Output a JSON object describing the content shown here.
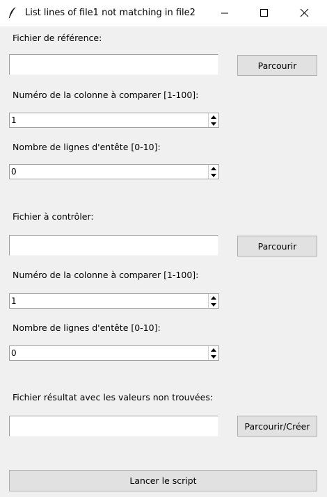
{
  "window": {
    "title": "List lines of file1 not matching in file2",
    "icon": "feather-icon"
  },
  "section1": {
    "file_label": "Fichier de référence:",
    "file_value": "",
    "browse_label": "Parcourir",
    "column_label": "Numéro de la colonne à comparer [1-100]:",
    "column_value": "1",
    "header_label": "Nombre de lignes d'entête [0-10]:",
    "header_value": "0"
  },
  "section2": {
    "file_label": "Fichier à contrôler:",
    "file_value": "",
    "browse_label": "Parcourir",
    "column_label": "Numéro de la colonne à comparer [1-100]:",
    "column_value": "1",
    "header_label": "Nombre de lignes d'entête [0-10]:",
    "header_value": "0"
  },
  "result": {
    "file_label": "Fichier résultat avec les valeurs non trouvées:",
    "file_value": "",
    "browse_label": "Parcourir/Créer"
  },
  "actions": {
    "launch_label": "Lancer le script"
  }
}
